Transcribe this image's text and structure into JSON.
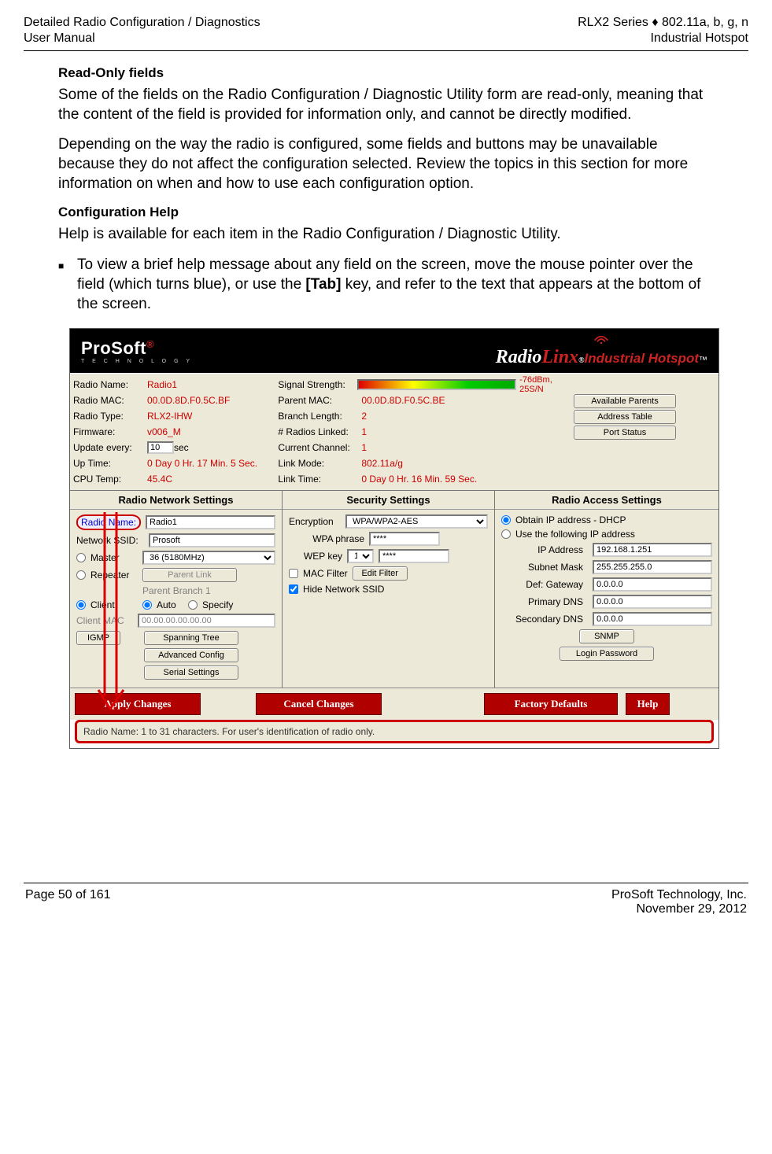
{
  "header": {
    "left_top": "Detailed Radio Configuration / Diagnostics",
    "right_top": "RLX2 Series ♦ 802.11a, b, g, n",
    "left_sub": "User Manual",
    "right_sub": "Industrial Hotspot"
  },
  "section1": {
    "h": "Read-Only fields",
    "p1": "Some of the fields on the Radio Configuration / Diagnostic Utility form are read-only, meaning that the content of the field is provided for information only, and cannot be directly modified.",
    "p2": "Depending on the way the radio is configured, some fields and buttons may be unavailable because they do not affect the configuration selected. Review the topics in this section for more information on when and how to use each configuration option."
  },
  "section2": {
    "h": "Configuration Help",
    "p1": "Help is available for each item in the Radio Configuration / Diagnostic Utility.",
    "li_a": "To view a brief help message about any field on the screen, move the mouse pointer over the field (which turns blue), or use the ",
    "li_b": "[Tab]",
    "li_c": " key, and refer to the text that appears at the bottom of the screen."
  },
  "shot": {
    "brand_left": "ProSoft",
    "brand_left_tag": "T E C H N O L O G Y",
    "brand_right_a": "Radio",
    "brand_right_b": "Linx",
    "brand_right_sup": "®",
    "brand_right_ih": "Industrial Hotspot",
    "brand_right_tm": "™",
    "info": {
      "l": [
        {
          "lbl": "Radio Name:",
          "val": "Radio1"
        },
        {
          "lbl": "Radio MAC:",
          "val": "00.0D.8D.F0.5C.BF"
        },
        {
          "lbl": "Radio Type:",
          "val": "RLX2-IHW"
        },
        {
          "lbl": "Firmware:",
          "val": "v006_M"
        },
        {
          "lbl": "Update every:",
          "val_input": "10",
          "val_suffix": " sec"
        },
        {
          "lbl": "Up Time:",
          "val": "0 Day 0 Hr. 17 Min. 5 Sec."
        },
        {
          "lbl": "CPU Temp:",
          "val": "45.4C"
        }
      ],
      "m": [
        {
          "lbl": "Signal Strength:",
          "sig": "-76dBm, 25S/N"
        },
        {
          "lbl": "Parent MAC:",
          "val": "00.0D.8D.F0.5C.BE"
        },
        {
          "lbl": "Branch Length:",
          "val": "2"
        },
        {
          "lbl": "# Radios Linked:",
          "val": "1"
        },
        {
          "lbl": "Current Channel:",
          "val": "1"
        },
        {
          "lbl": "Link Mode:",
          "val": "802.11a/g"
        },
        {
          "lbl": "Link Time:",
          "val": "0 Day 0 Hr. 16 Min. 59 Sec."
        }
      ],
      "btns": [
        "Available Parents",
        "Address Table",
        "Port Status"
      ]
    },
    "sects": [
      "Radio Network Settings",
      "Security Settings",
      "Radio Access Settings"
    ],
    "net": {
      "radio_name_lbl": "Radio Name:",
      "radio_name_val": "Radio1",
      "ssid_lbl": "Network SSID:",
      "ssid_val": "Prosoft",
      "master": "Master",
      "chan": "36 (5180MHz)",
      "repeater": "Repeater",
      "parent_link": "Parent Link",
      "parent_branch": "Parent Branch 1",
      "client": "Client",
      "auto": "Auto",
      "specify": "Specify",
      "client_mac_lbl": "Client MAC",
      "client_mac_val": "00.00.00.00.00.00",
      "igmp": "IGMP",
      "spanning": "Spanning Tree",
      "adv": "Advanced Config",
      "serial": "Serial Settings"
    },
    "sec": {
      "enc_lbl": "Encryption",
      "enc_val": "WPA/WPA2-AES",
      "wpa_lbl": "WPA phrase",
      "wpa_val": "****",
      "wep_lbl": "WEP key",
      "wep_sel": "1",
      "wep_val": "****",
      "mac_lbl": "MAC Filter",
      "mac_btn": "Edit Filter",
      "hide": "Hide Network SSID"
    },
    "acc": {
      "dhcp": "Obtain IP address - DHCP",
      "usefixed": "Use the following IP address",
      "ip_lbl": "IP Address",
      "ip_val": "192.168.1.251",
      "mask_lbl": "Subnet Mask",
      "mask_val": "255.255.255.0",
      "gw_lbl": "Def: Gateway",
      "gw_val": "0.0.0.0",
      "dns1_lbl": "Primary DNS",
      "dns1_val": "0.0.0.0",
      "dns2_lbl": "Secondary DNS",
      "dns2_val": "0.0.0.0",
      "snmp": "SNMP",
      "login": "Login Password"
    },
    "bottom": {
      "apply": "Apply Changes",
      "cancel": "Cancel Changes",
      "factory": "Factory Defaults",
      "help": "Help"
    },
    "help_strip": "Radio Name: 1 to 31 characters.  For user's identification of radio only."
  },
  "footer": {
    "page": "Page 50 of 161",
    "company": "ProSoft Technology, Inc.",
    "date": "November 29, 2012"
  }
}
